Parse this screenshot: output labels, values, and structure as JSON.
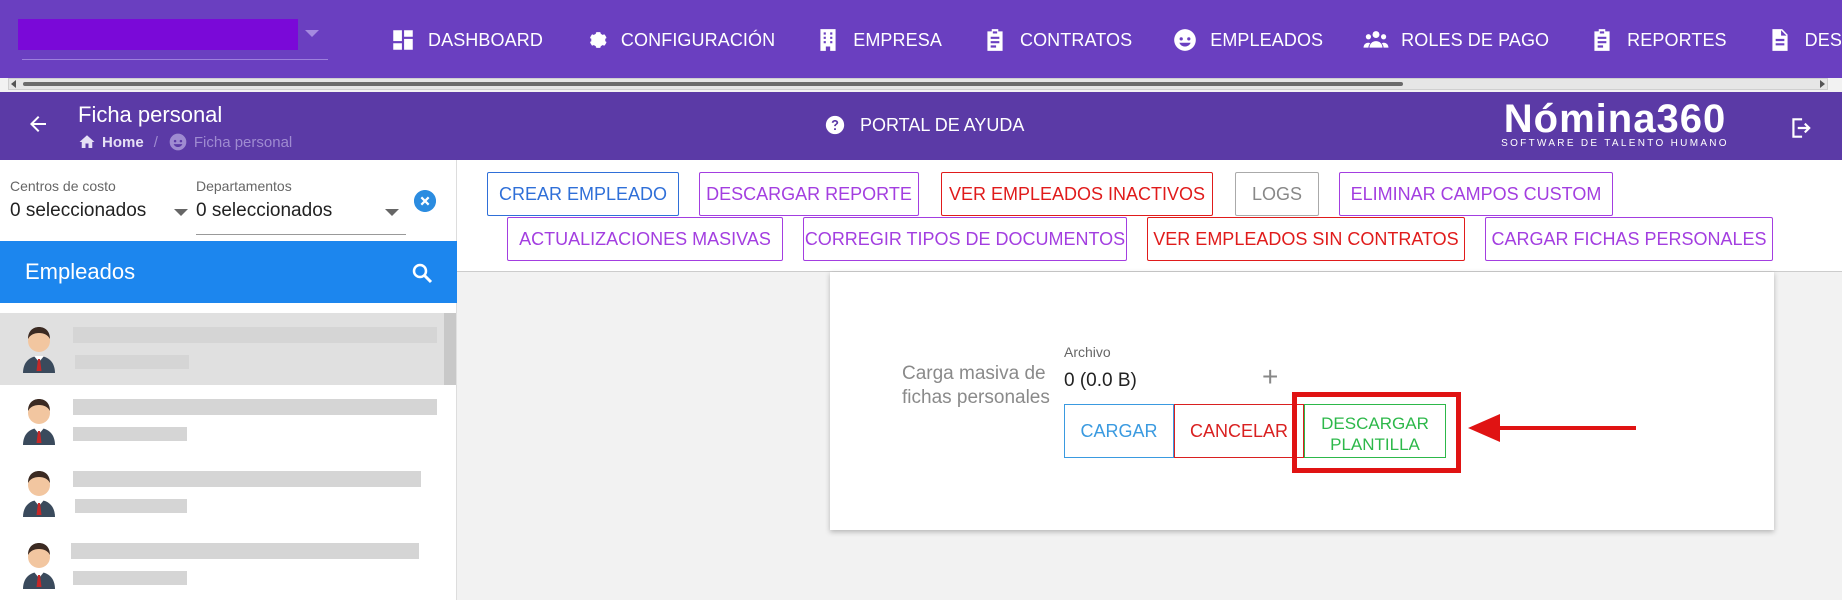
{
  "nav": {
    "items": [
      {
        "label": "DASHBOARD",
        "icon": "dashboard-icon"
      },
      {
        "label": "CONFIGURACIÓN",
        "icon": "gear-icon"
      },
      {
        "label": "EMPRESA",
        "icon": "building-icon"
      },
      {
        "label": "CONTRATOS",
        "icon": "clipboard-icon"
      },
      {
        "label": "EMPLEADOS",
        "icon": "face-icon"
      },
      {
        "label": "ROLES DE PAGO",
        "icon": "people-icon"
      },
      {
        "label": "REPORTES",
        "icon": "clipboard-icon"
      },
      {
        "label": "DESTAJO",
        "icon": "document-icon"
      }
    ]
  },
  "header": {
    "title": "Ficha personal",
    "breadcrumb": {
      "home": "Home",
      "current": "Ficha personal"
    },
    "help": "PORTAL DE AYUDA",
    "logo": {
      "name": "Nómina360",
      "tagline": "SOFTWARE DE TALENTO HUMANO"
    }
  },
  "filters": {
    "cost_centers": {
      "label": "Centros de costo",
      "value": "0 seleccionados"
    },
    "departments": {
      "label": "Departamentos",
      "value": "0 seleccionados"
    }
  },
  "employees": {
    "title": "Empleados",
    "rows": [
      {
        "selected": true
      },
      {
        "selected": false
      },
      {
        "selected": false
      },
      {
        "selected": false
      }
    ]
  },
  "actions": {
    "crear": "CREAR EMPLEADO",
    "descargar_reporte": "DESCARGAR REPORTE",
    "inactivos": "VER EMPLEADOS INACTIVOS",
    "logs": "LOGS",
    "eliminar": "ELIMINAR CAMPOS CUSTOM",
    "actualizaciones": "ACTUALIZACIONES MASIVAS",
    "corregir": "CORREGIR TIPOS DE DOCUMENTOS",
    "sin_contratos": "VER EMPLEADOS SIN CONTRATOS",
    "cargar_fichas": "CARGAR FICHAS PERSONALES"
  },
  "upload": {
    "label": "Carga masiva de fichas personales",
    "file_label": "Archivo",
    "file_value": "0 (0.0 B)",
    "add": "+",
    "cargar": "CARGAR",
    "cancelar": "CANCELAR",
    "descargar_line1": "DESCARGAR",
    "descargar_line2": "PLANTILLA"
  },
  "colors": {
    "topbar": "#6a3fc0",
    "subheader": "#5b3aa6",
    "employees_header": "#1c86ee",
    "highlight": "#e01313"
  }
}
